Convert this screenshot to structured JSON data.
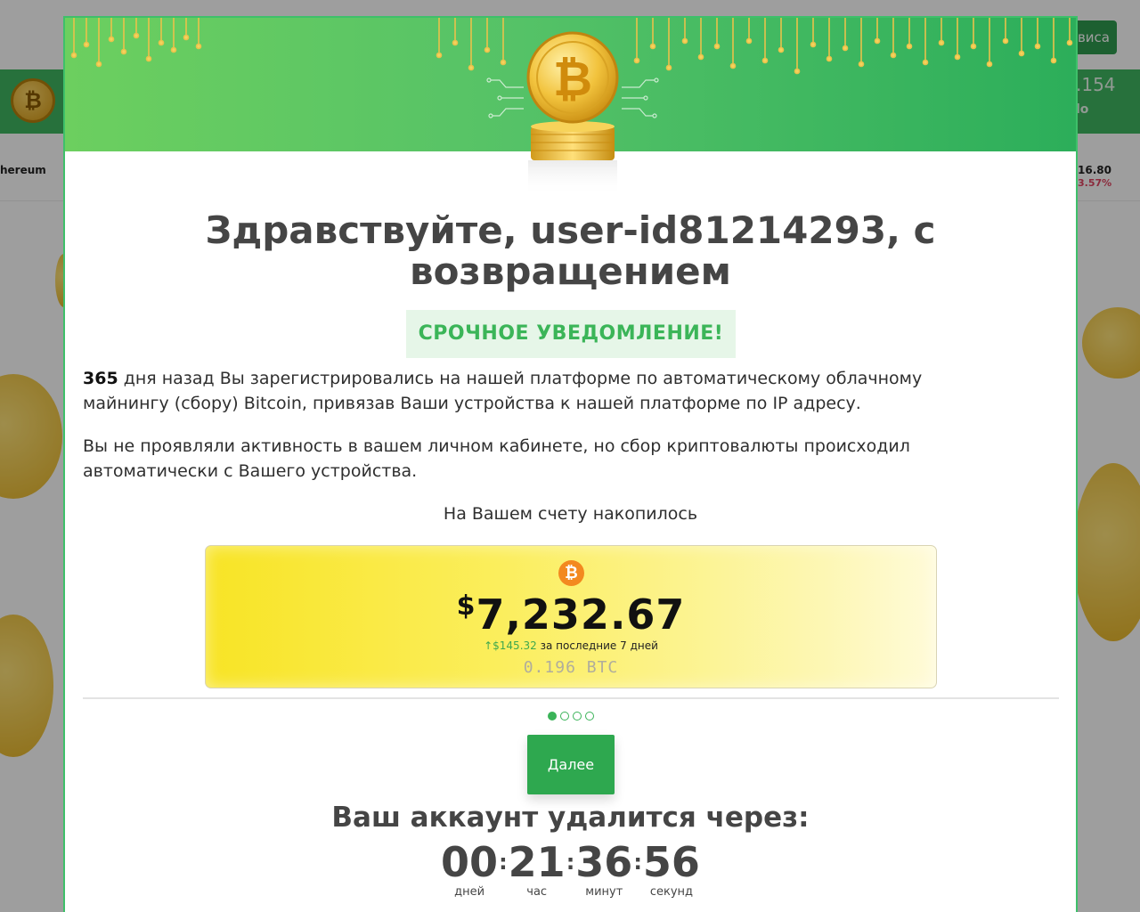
{
  "background": {
    "service_button_label": "виса",
    "price_main": ".154",
    "price_sub": "lo",
    "ticker_left_name": "hereum",
    "ticker_right_price": "16.80",
    "ticker_right_change": "3.57%",
    "logo_symbol": "₿"
  },
  "modal": {
    "greeting": "Здравствуйте, user-id81214293, с возвращением",
    "notice": "СРОЧНОЕ УВЕДОМЛЕНИЕ!",
    "paragraph1_days": "365",
    "paragraph1_text": " дня назад Вы зарегистрировались на нашей платформе по автоматическому облачному майнингу (сбору) Bitcoin, привязав Ваши устройства к нашей платформе по IP адресу.",
    "paragraph2": "Вы не проявляли активность в вашем личном кабинете, но сбор криптовалюты происходил автоматически с Вашего устройства.",
    "accumulated_label": "На Вашем счету накопилось",
    "balance": {
      "btc_symbol": "₿",
      "currency_symbol": "$",
      "amount": "7,232.67",
      "gain_arrow": "↑",
      "gain_value": "$145.32",
      "gain_period": " за последние 7 дней",
      "btc_amount": "0.196 BTC"
    },
    "pagination": {
      "total": 4,
      "active": 0
    },
    "next_button": "Далее",
    "delete_label": "Ваш аккаунт удалится через:",
    "countdown": {
      "days": "00",
      "days_label": "дней",
      "hours": "21",
      "hours_label": "час",
      "minutes": "36",
      "minutes_label": "минут",
      "seconds": "56",
      "seconds_label": "секунд"
    }
  },
  "colors": {
    "brand_green": "#2ea84f",
    "notice_green": "#3bb558",
    "btc_orange": "#f3891f"
  }
}
